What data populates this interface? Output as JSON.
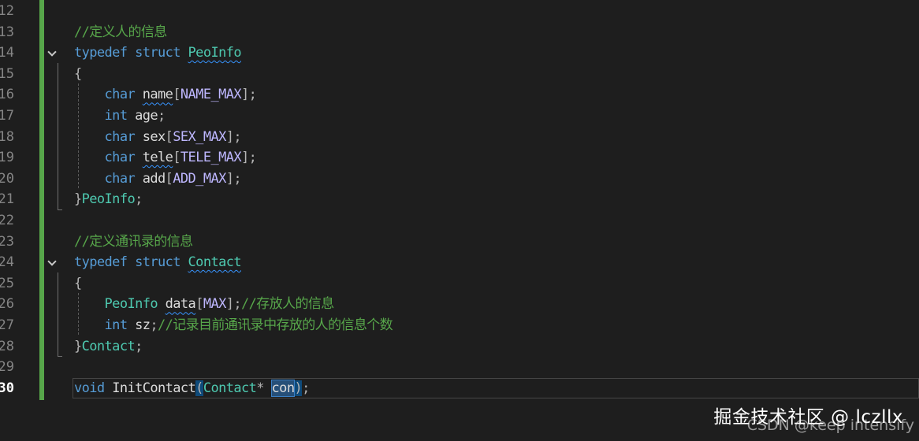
{
  "editor": {
    "active_line": "30",
    "lines": [
      {
        "no": "12",
        "code": []
      },
      {
        "no": "13",
        "code": [
          {
            "t": "//定义人的信息",
            "c": "cm"
          }
        ]
      },
      {
        "no": "14",
        "fold": true,
        "code": [
          {
            "t": "typedef",
            "c": "kw"
          },
          {
            "t": " ",
            "c": "pn"
          },
          {
            "t": "struct",
            "c": "kw"
          },
          {
            "t": " ",
            "c": "pn"
          },
          {
            "t": "PeoInfo",
            "c": "ty",
            "sq": true
          }
        ]
      },
      {
        "no": "15",
        "code": [
          {
            "t": "{",
            "c": "pn"
          }
        ]
      },
      {
        "no": "16",
        "code": [
          {
            "t": "    ",
            "c": "pn"
          },
          {
            "t": "char",
            "c": "kw"
          },
          {
            "t": " ",
            "c": "pn"
          },
          {
            "t": "name",
            "c": "var",
            "sq": true
          },
          {
            "t": "[",
            "c": "pn"
          },
          {
            "t": "NAME_MAX",
            "c": "mac"
          },
          {
            "t": "];",
            "c": "pn"
          }
        ]
      },
      {
        "no": "17",
        "code": [
          {
            "t": "    ",
            "c": "pn"
          },
          {
            "t": "int",
            "c": "kw"
          },
          {
            "t": " ",
            "c": "pn"
          },
          {
            "t": "age",
            "c": "var"
          },
          {
            "t": ";",
            "c": "pn"
          }
        ]
      },
      {
        "no": "18",
        "code": [
          {
            "t": "    ",
            "c": "pn"
          },
          {
            "t": "char",
            "c": "kw"
          },
          {
            "t": " ",
            "c": "pn"
          },
          {
            "t": "sex",
            "c": "var"
          },
          {
            "t": "[",
            "c": "pn"
          },
          {
            "t": "SEX_MAX",
            "c": "mac"
          },
          {
            "t": "];",
            "c": "pn"
          }
        ]
      },
      {
        "no": "19",
        "code": [
          {
            "t": "    ",
            "c": "pn"
          },
          {
            "t": "char",
            "c": "kw"
          },
          {
            "t": " ",
            "c": "pn"
          },
          {
            "t": "tele",
            "c": "var",
            "sq": true
          },
          {
            "t": "[",
            "c": "pn"
          },
          {
            "t": "TELE_MAX",
            "c": "mac"
          },
          {
            "t": "];",
            "c": "pn"
          }
        ]
      },
      {
        "no": "20",
        "code": [
          {
            "t": "    ",
            "c": "pn"
          },
          {
            "t": "char",
            "c": "kw"
          },
          {
            "t": " ",
            "c": "pn"
          },
          {
            "t": "add",
            "c": "var"
          },
          {
            "t": "[",
            "c": "pn"
          },
          {
            "t": "ADD_MAX",
            "c": "mac"
          },
          {
            "t": "];",
            "c": "pn"
          }
        ]
      },
      {
        "no": "21",
        "code": [
          {
            "t": "}",
            "c": "pn"
          },
          {
            "t": "PeoInfo",
            "c": "ty"
          },
          {
            "t": ";",
            "c": "pn"
          }
        ]
      },
      {
        "no": "22",
        "code": []
      },
      {
        "no": "23",
        "code": [
          {
            "t": "//定义通讯录的信息",
            "c": "cm"
          }
        ]
      },
      {
        "no": "24",
        "fold": true,
        "code": [
          {
            "t": "typedef",
            "c": "kw"
          },
          {
            "t": " ",
            "c": "pn"
          },
          {
            "t": "struct",
            "c": "kw"
          },
          {
            "t": " ",
            "c": "pn"
          },
          {
            "t": "Contact",
            "c": "ty",
            "sq": true
          }
        ]
      },
      {
        "no": "25",
        "code": [
          {
            "t": "{",
            "c": "pn"
          }
        ]
      },
      {
        "no": "26",
        "code": [
          {
            "t": "    ",
            "c": "pn"
          },
          {
            "t": "PeoInfo",
            "c": "ty"
          },
          {
            "t": " ",
            "c": "pn"
          },
          {
            "t": "data",
            "c": "var",
            "sq": true
          },
          {
            "t": "[",
            "c": "pn"
          },
          {
            "t": "MAX",
            "c": "mac"
          },
          {
            "t": "];",
            "c": "pn"
          },
          {
            "t": "//存放人的信息",
            "c": "cm"
          }
        ]
      },
      {
        "no": "27",
        "code": [
          {
            "t": "    ",
            "c": "pn"
          },
          {
            "t": "int",
            "c": "kw"
          },
          {
            "t": " ",
            "c": "pn"
          },
          {
            "t": "sz",
            "c": "var"
          },
          {
            "t": ";",
            "c": "pn"
          },
          {
            "t": "//记录目前通讯录中存放的人的信息个数",
            "c": "cm"
          }
        ]
      },
      {
        "no": "28",
        "code": [
          {
            "t": "}",
            "c": "pn"
          },
          {
            "t": "Contact",
            "c": "ty"
          },
          {
            "t": ";",
            "c": "pn"
          }
        ]
      },
      {
        "no": "29",
        "code": []
      },
      {
        "no": "30",
        "code": [
          {
            "t": "void",
            "c": "kw"
          },
          {
            "t": " ",
            "c": "pn"
          },
          {
            "t": "InitContact",
            "c": "fn"
          },
          {
            "t": "(",
            "c": "pn",
            "hl": "paren"
          },
          {
            "t": "Contact",
            "c": "ty"
          },
          {
            "t": "* ",
            "c": "pn"
          },
          {
            "t": "con",
            "c": "var",
            "hl": "sel"
          },
          {
            "t": ")",
            "c": "pn",
            "hl": "paren"
          },
          {
            "t": ";",
            "c": "pn"
          }
        ]
      }
    ]
  },
  "watermark": {
    "cn": "掘金技术社区 @ lczllx",
    "en": "CSDN @keep intensify"
  },
  "colors": {
    "background": "#1e1e1e",
    "keyword": "#569cd6",
    "type": "#4ec9b0",
    "macro": "#beb7ff",
    "comment": "#57a64a",
    "change_bar": "#57a64a"
  }
}
